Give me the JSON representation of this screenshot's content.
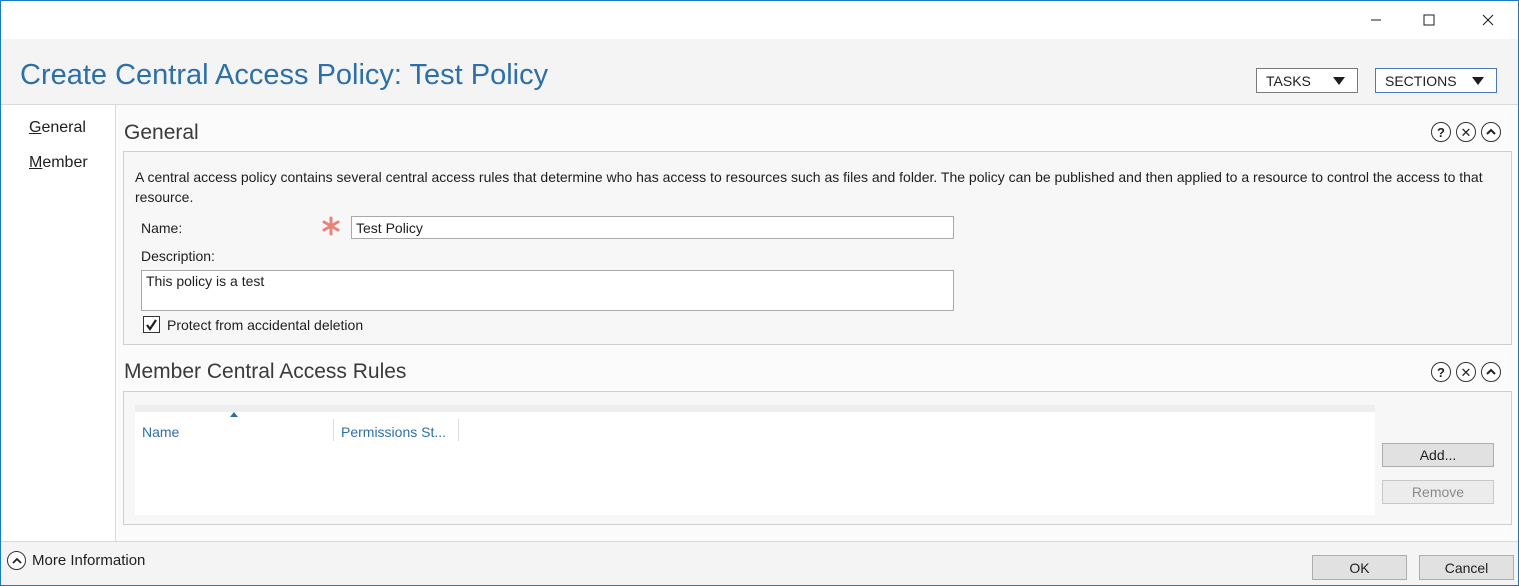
{
  "window": {
    "title": "Create Central Access Policy: Test Policy",
    "controls": [
      "minimize-icon",
      "maximize-icon",
      "close-icon"
    ]
  },
  "header": {
    "tasks_label": "TASKS",
    "sections_label": "SECTIONS"
  },
  "nav": {
    "items": [
      {
        "label_first": "G",
        "label_rest": "eneral"
      },
      {
        "label_first": "M",
        "label_rest": "ember"
      }
    ]
  },
  "general": {
    "title": "General",
    "description": "A central access policy contains several central access rules that determine who has access to resources such as files and folder. The policy can be published and then applied to a resource to control the access to that resource.",
    "name_label": "Name:",
    "name_value": "Test Policy",
    "description_label": "Description:",
    "description_value": "This policy is a test",
    "protect_label": "Protect from accidental deletion",
    "protect_checked": true
  },
  "member": {
    "title": "Member Central Access Rules",
    "columns": [
      "Name",
      "Permissions St..."
    ],
    "rows": [],
    "add_label": "Add...",
    "remove_label": "Remove"
  },
  "footer": {
    "more_info_label": "More Information",
    "ok_label": "OK",
    "cancel_label": "Cancel"
  },
  "colors": {
    "title_blue": "#2e6fa7",
    "required_star": "#e8837a",
    "window_border": "#1979ca"
  }
}
